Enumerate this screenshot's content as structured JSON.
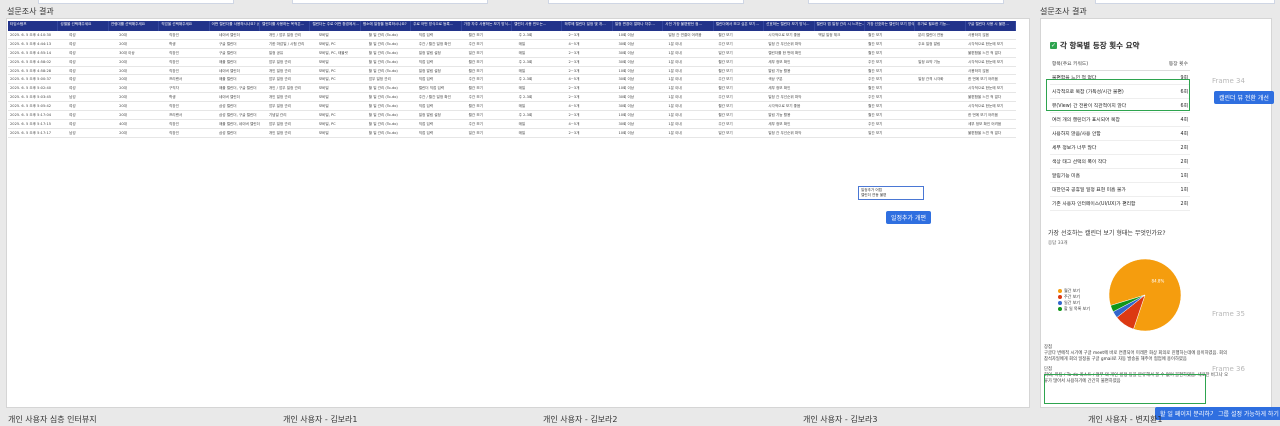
{
  "frames": {
    "main_title": "설문조사 결과",
    "right_title": "설문조사 결과",
    "bottom": [
      "개인 사용자 심층 인터뷰지",
      "개인 사용자 - 김보라1",
      "개인 사용자 - 김보라2",
      "개인 사용자 - 김보라3",
      "개인 사용자 - 변지환1"
    ],
    "ghosts": [
      "Frame 34",
      "Frame 35",
      "Frame 36"
    ]
  },
  "table": {
    "headers": [
      "타임스탬프",
      "성별을 선택해주세요",
      "연령대를 선택해주세요",
      "직업을 선택해주세요",
      "어떤 캘린더를 사용하시나요? (중…",
      "캘린더를 사용하는 목적은…",
      "캘린더는 주로 어떤 환경에서…",
      "평소에 일정을 등록하시나요?",
      "주로 어떤 방식으로 등록…",
      "가장 자주 사용하는 보기 방식…",
      "캘린더 사용 빈도는…",
      "하루에 캘린더 일정 몇 개…",
      "일정 변경이 얼마나 자주…",
      "사전 가장 불편했던 점…",
      "캘린더에서 보고 싶은 보기…",
      "선호하는 캘린더 보기 방식…",
      "캘린더 앱 일정 관리 시 느끼는…",
      "가장 선호하는 캘린더 보기 방식은…",
      "추가로 필요한 기능…",
      "구글 캘린더 사용 시 불편…"
    ],
    "rows": [
      [
        "2025. 6. 5 오후 4:10:30",
        "여성",
        "20대",
        "직장인",
        "네이버 캘린더",
        "개인 / 업무 일정 관리",
        "모바일",
        "할 일 관리 (To-do)",
        "직접 입력",
        "월간 보기",
        "주 2-3회",
        "2~3개",
        "10회 이상",
        "일정 간 연결이 어려움",
        "월간 보기",
        "시각적으로 보기 좋음",
        "맥일 일정 체크",
        "월간 보기",
        "분리 캘린더 연동",
        "사용하지 않음"
      ],
      [
        "2025. 6. 5 오후 4:44:13",
        "여성",
        "20대",
        "학생",
        "구글 캘린더",
        "기한 마감일 / 시험 관리",
        "모바일, PC",
        "할 일 관리 (To-do)",
        "주간 / 월간 일정 확인",
        "주간 보기",
        "매일",
        "4~5개",
        "30회 이상",
        "1분 이내",
        "주간 보기",
        "일정 간 우선순위 파악",
        "",
        "월간 보기",
        "주요 일정 알림",
        "시각적으로 한눈에 보기"
      ],
      [
        "2025. 6. 5 오후 4:55:14",
        "여성",
        "30대 이상",
        "직장인",
        "구글 캘린더",
        "일정 공유",
        "모바일, PC, 태블릿",
        "할 일 관리 (To-do)",
        "일정 알림 설정",
        "일간 보기",
        "매일",
        "2~3개",
        "30회 이상",
        "1분 이내",
        "일간 보기",
        "캘린더를 한 번에 확인",
        "",
        "월간 보기",
        "",
        "불편함을 느낀 적 없다"
      ],
      [
        "2025. 6. 5 오후 4:58:02",
        "여성",
        "20대",
        "직장인",
        "애플 캘린더",
        "업무 일정 관리",
        "모바일",
        "할 일 관리 (To-do)",
        "직접 입력",
        "월간 보기",
        "주 2-3회",
        "2~3개",
        "30회 이상",
        "1분 이내",
        "월간 보기",
        "세부 정보 확인",
        "",
        "주간 보기",
        "일정 요약 기능",
        "시각적으로 한눈에 보기"
      ],
      [
        "2025. 6. 5 오후 4:58:28",
        "여성",
        "20대",
        "직장인",
        "네이버 캘린더",
        "개인 일정 관리",
        "모바일, PC",
        "할 일 관리 (To-do)",
        "일정 알림 설정",
        "월간 보기",
        "매일",
        "2~3개",
        "10회 이상",
        "1분 이내",
        "월간 보기",
        "알림 기능 활용",
        "",
        "월간 보기",
        "",
        "사용하지 않음"
      ],
      [
        "2025. 6. 5 오후 5:00:37",
        "여성",
        "20대",
        "프리랜서",
        "애플 캘린더",
        "업무 일정 관리",
        "모바일, PC",
        "업무 일정 관리",
        "직접 입력",
        "주간 보기",
        "주 2-3회",
        "4~5개",
        "30회 이상",
        "1분 이내",
        "주간 보기",
        "색상 구분",
        "",
        "주간 보기",
        "일정 간격 시각화",
        "한 번에 보기 어려움"
      ],
      [
        "2025. 6. 5 오후 5:02:40",
        "여성",
        "20대",
        "구직자",
        "애플 캘린더, 구글 캘린더",
        "개인 / 업무 일정 관리",
        "모바일",
        "할 일 관리 (To-do)",
        "캘린더 직접 입력",
        "월간 보기",
        "매일",
        "2~3개",
        "10회 이상",
        "1분 이내",
        "월간 보기",
        "세부 정보 확인",
        "",
        "월간 보기",
        "",
        "시각적으로 한눈에 보기"
      ],
      [
        "2025. 6. 5 오후 5:03:45",
        "남성",
        "20대",
        "학생",
        "네이버 캘린더",
        "개인 일정 관리",
        "모바일",
        "할 일 관리 (To-do)",
        "주간 / 월간 일정 확인",
        "주간 보기",
        "주 2-3회",
        "2~3개",
        "30회 이상",
        "1분 이내",
        "주간 보기",
        "일정 간 우선순위 파악",
        "",
        "주간 보기",
        "",
        "불편함을 느낀 적 없다"
      ],
      [
        "2025. 6. 5 오후 5:05:42",
        "여성",
        "20대",
        "직장인",
        "삼성 캘린더",
        "업무 일정 관리",
        "모바일",
        "할 일 관리 (To-do)",
        "직접 입력",
        "월간 보기",
        "매일",
        "4~5개",
        "30회 이상",
        "1분 이내",
        "월간 보기",
        "시각적으로 보기 좋음",
        "",
        "월간 보기",
        "",
        "시각적으로 한눈에 보기"
      ],
      [
        "2025. 6. 5 오후 5:17:04",
        "여성",
        "20대",
        "프리랜서",
        "삼성 캘린더, 구글 캘린더",
        "기념일 관리",
        "모바일, PC",
        "할 일 관리 (To-do)",
        "일정 알림 설정",
        "월간 보기",
        "주 2-3회",
        "2~3개",
        "10회 이상",
        "1분 이내",
        "월간 보기",
        "알림 기능 활용",
        "",
        "월간 보기",
        "",
        "한 번에 보기 어려움"
      ],
      [
        "2025. 6. 5 오후 5:17:15",
        "여성",
        "40대",
        "직장인",
        "애플 캘린더, 네이버 캘린더",
        "업무 일정 관리",
        "모바일, PC",
        "할 일 관리 (To-do)",
        "직접 입력",
        "주간 보기",
        "매일",
        "4~5개",
        "30회 이상",
        "1분 이내",
        "주간 보기",
        "세부 정보 확인",
        "",
        "주간 보기",
        "",
        "세부 정보 확인 어려움"
      ],
      [
        "2025. 6. 5 오후 5:17:17",
        "남성",
        "20대",
        "직장인",
        "삼성 캘린더",
        "개인 일정 관리",
        "모바일",
        "할 일 관리 (To-do)",
        "직접 입력",
        "일간 보기",
        "매일",
        "2~3개",
        "10회 이상",
        "1분 이내",
        "일간 보기",
        "일정 간 우선순위 파악",
        "",
        "일간 보기",
        "",
        "불편함을 느낀 적 없다"
      ]
    ]
  },
  "overlays": {
    "box1_line1": "일정추가 어렵",
    "box1_line2": "캘린더 연동 불편",
    "btn_add": "일정추가 개편",
    "btn_right": "캘린더 뷰 전환 개선",
    "btn_separate": "할 일 페이지 분리하기",
    "btn_group": "그룹 설정 가능하게 하기"
  },
  "summary": {
    "title": "각 항목별 등장 횟수 요약",
    "col_item": "항목(주요 키워드)",
    "col_count": "등장 횟수",
    "rows": [
      {
        "item": "불편함을 느낀 적 없다",
        "count": "9회"
      },
      {
        "item": "시각적으로 복잡 (가독성/시간 불편)",
        "count": "6회"
      },
      {
        "item": "뷰(View) 간 전환이 직관적이지 않다",
        "count": "6회"
      },
      {
        "item": "여러 개의 캘린더가 표시되어 복잡",
        "count": "4회"
      },
      {
        "item": "사용하지 않음/사용 안함",
        "count": "4회"
      },
      {
        "item": "세부 정보가 너무 많다",
        "count": "2회"
      },
      {
        "item": "색상 태그 선택의 폭이 작다",
        "count": "2회"
      },
      {
        "item": "알림기능 미흡",
        "count": "1회"
      },
      {
        "item": "대한민국 공휴일 일정 표현 미흡 불가",
        "count": "1회"
      },
      {
        "item": "기존 사용자 인터페이스(UI/UX)가 편리함",
        "count": "2회"
      }
    ]
  },
  "chart_data": {
    "type": "pie",
    "title": "가장 선호하는 캘린더 보기 형태는 무엇인가요?",
    "subtitle": "응답 33개",
    "categories": [
      "월간 보기",
      "주간 보기",
      "일간 보기",
      "할 일 목록 보기"
    ],
    "values": [
      84.8,
      9.1,
      3.0,
      3.0
    ],
    "slice_labels": [
      "84.8%",
      "",
      "",
      ""
    ],
    "colors": [
      "#f59d0e",
      "#dc3912",
      "#3366cc",
      "#109618"
    ]
  },
  "notes": {
    "label1": "장점",
    "text1": "구글다 번에적 시기에 구글 meet에 바로 연결되어 미래한 화상 회의로 진행하는데에 용이하였음. 회의 참석자일에게 회의 일정을 구글 gmail로 자동 발송을 해주어 협업에 용이하였음",
    "label2": "단점",
    "text2": "회의, 미팅 / To-do 리스트 / 업무 외 개인 일정 등을 분류해서 볼 수 없어 불편하였음. 새로한 비그나 오류가 많아서 사용하기에 간간히 불편하였음"
  }
}
